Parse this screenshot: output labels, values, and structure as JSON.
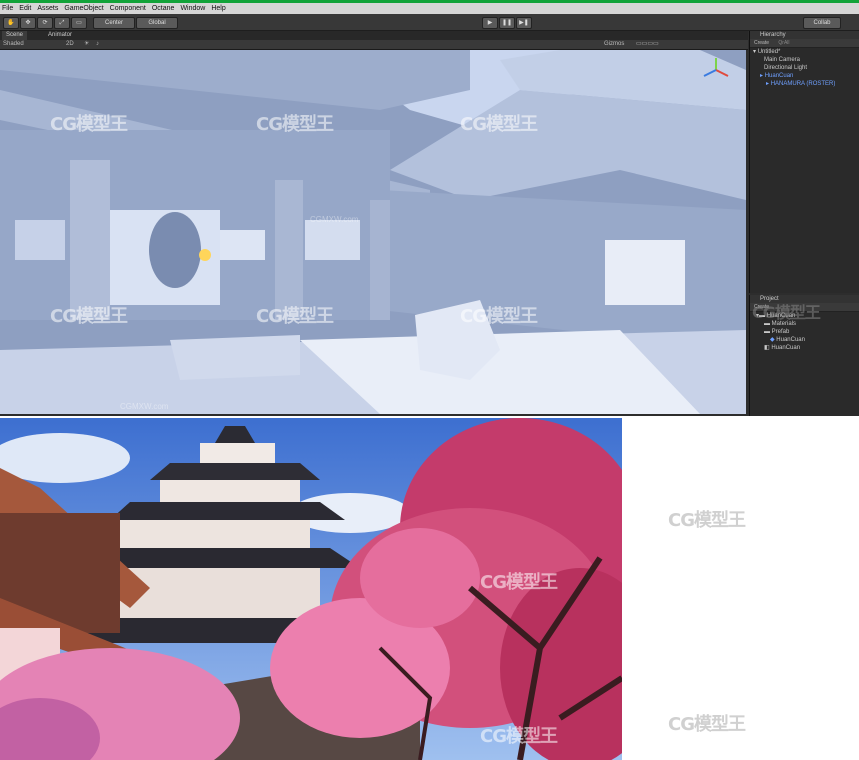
{
  "menu": [
    "File",
    "Edit",
    "Assets",
    "GameObject",
    "Component",
    "Octane",
    "Window",
    "Help"
  ],
  "toolbar": {
    "pivot_label": "Center",
    "space_label": "Global",
    "play_icon": "play-icon",
    "pause_icon": "pause-icon",
    "step_icon": "step-icon",
    "collab_label": "Collab"
  },
  "scene": {
    "tabs": [
      "Scene",
      "Animator"
    ],
    "shading_mode": "Shaded",
    "mode_2d": "2D",
    "gizmos_label": "Gizmos"
  },
  "hierarchy": {
    "title": "Hierarchy",
    "create_label": "Create",
    "search_placeholder": "QrAll",
    "items": [
      "Untitled*",
      "Main Camera",
      "Directional Light",
      "HuanCuan",
      "HANAMURA (ROSTER)"
    ]
  },
  "project": {
    "title": "Project",
    "create_label": "Create",
    "items": [
      "HuanCuan",
      "Materials",
      "Prefab",
      "HuanCuan",
      "HuanCuan"
    ]
  },
  "watermarks": {
    "logo": "CG模型王",
    "url": "CGMXW.com"
  },
  "colors": {
    "unity_dark": "#2d2d2d",
    "brand_green": "#12a339",
    "viewport_sky": "#8fa2c4",
    "blossom_pink": "#e0629c"
  }
}
